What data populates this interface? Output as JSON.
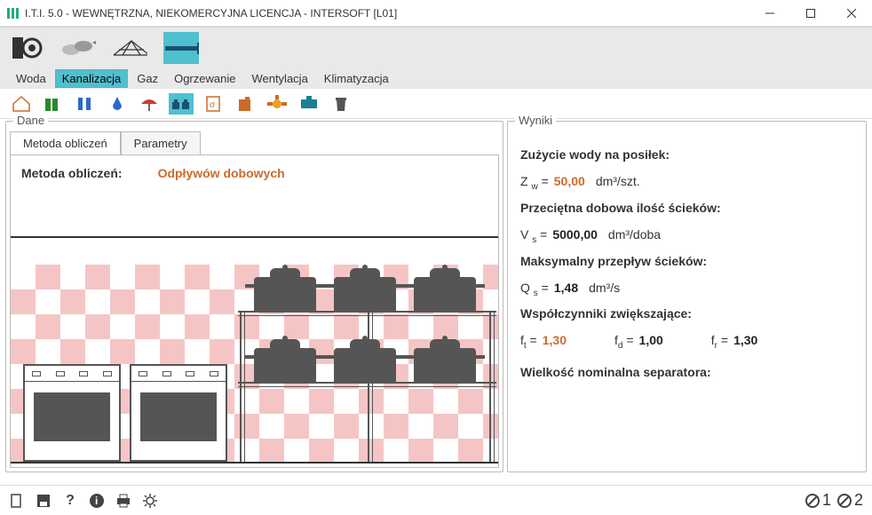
{
  "window": {
    "title": "I.T.I. 5.0 - WEWNĘTRZNA, NIEKOMERCYJNA LICENCJA - INTERSOFT [L01]"
  },
  "menu": {
    "items": [
      "Woda",
      "Kanalizacja",
      "Gaz",
      "Ogrzewanie",
      "Wentylacja",
      "Klimatyzacja"
    ],
    "active": 1
  },
  "panel_left": {
    "title": "Dane",
    "tabs": [
      "Metoda obliczeń",
      "Parametry"
    ],
    "method_label": "Metoda obliczeń:",
    "method_value": "Odpływów dobowych"
  },
  "panel_right": {
    "title": "Wyniki",
    "r1": {
      "heading": "Zużycie wody na posiłek:",
      "sym": "Z",
      "sub": "w",
      "val": "50,00",
      "unit": "dm³/szt."
    },
    "r2": {
      "heading": "Przeciętna dobowa ilość ścieków:",
      "sym": "V",
      "sub": "s",
      "val": "5000,00",
      "unit": "dm³/doba"
    },
    "r3": {
      "heading": "Maksymalny przepływ ścieków:",
      "sym": "Q",
      "sub": "s",
      "val": "1,48",
      "unit": "dm³/s"
    },
    "coef": {
      "heading": "Współczynniki zwiększające:",
      "ft": {
        "sym": "f",
        "sub": "t",
        "val": "1,30"
      },
      "fd": {
        "sym": "f",
        "sub": "d",
        "val": "1,00"
      },
      "fr": {
        "sym": "f",
        "sub": "r",
        "val": "1,30"
      }
    },
    "r4": {
      "heading": "Wielkość nominalna separatora:"
    }
  },
  "status": {
    "page1": "1",
    "page2": "2"
  }
}
